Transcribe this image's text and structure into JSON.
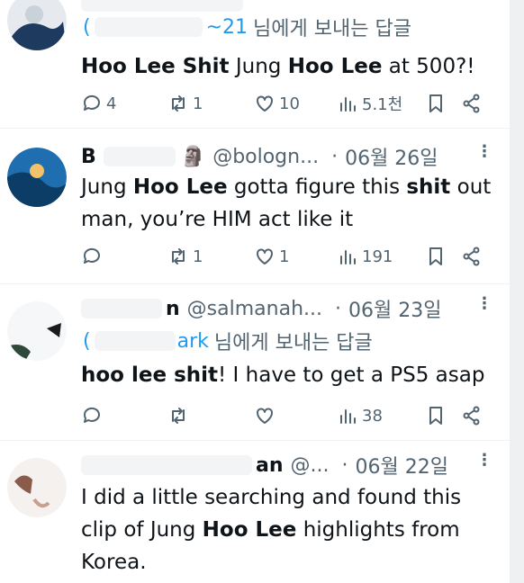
{
  "tweets": [
    {
      "name": "",
      "handle": "",
      "date": "",
      "more_icon": "more-dots-icon",
      "reply_to": {
        "mention": "~21",
        "suffix": "님에게 보내는 답글"
      },
      "text": [
        {
          "t": "Hoo Lee Shit",
          "b": true
        },
        {
          "t": " Jung ",
          "b": false
        },
        {
          "t": "Hoo Lee",
          "b": true
        },
        {
          "t": " at 500?!",
          "b": false
        }
      ],
      "actions": {
        "replies": "4",
        "reposts": "1",
        "likes": "10",
        "views": "5.1천"
      }
    },
    {
      "name": "B",
      "emoji": "🗿",
      "handle": "@bologn...",
      "date": "06월 26일",
      "more_icon": "more-dots-icon",
      "text": [
        {
          "t": "Jung ",
          "b": false
        },
        {
          "t": "Hoo Lee",
          "b": true
        },
        {
          "t": " gotta figure this ",
          "b": false
        },
        {
          "t": "shit",
          "b": true
        },
        {
          "t": " out man, you’re HIM act like it",
          "b": false
        }
      ],
      "actions": {
        "replies": "",
        "reposts": "1",
        "likes": "1",
        "views": "191"
      }
    },
    {
      "name": "n",
      "handle": "@salmanah...",
      "date": "06월 23일",
      "more_icon": "more-dots-icon",
      "reply_to": {
        "mention": "ark",
        "suffix": "님에게 보내는 답글"
      },
      "text": [
        {
          "t": "hoo lee shit",
          "b": true
        },
        {
          "t": "! I have to get a PS5 asap",
          "b": false
        }
      ],
      "actions": {
        "replies": "",
        "reposts": "",
        "likes": "",
        "views": "38"
      }
    },
    {
      "name": "an",
      "handle": "@...",
      "date": "06월 22일",
      "more_icon": "more-dots-icon",
      "text": [
        {
          "t": "I did a little searching and found this clip of Jung ",
          "b": false
        },
        {
          "t": "Hoo Lee",
          "b": true
        },
        {
          "t": " highlights from Korea.",
          "b": false
        }
      ]
    }
  ],
  "icons": {
    "reply": "reply-bubble-icon",
    "repost": "repost-arrows-icon",
    "like": "heart-icon",
    "views": "views-bars-icon",
    "bookmark": "bookmark-icon",
    "share": "share-icon"
  },
  "colors": {
    "text": "#0f1419",
    "secondary": "#536471",
    "accent": "#1d9bf0",
    "divider": "#eff3f4"
  }
}
